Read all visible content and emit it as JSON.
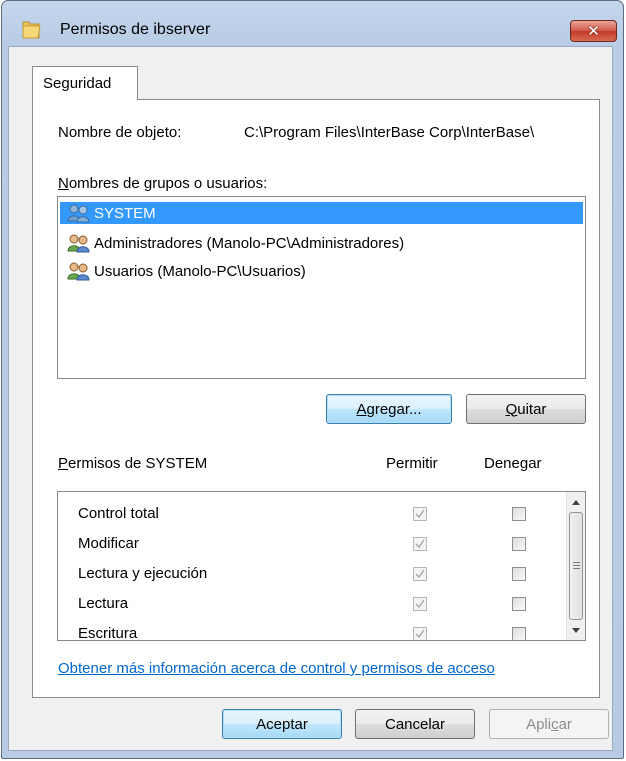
{
  "window": {
    "title": "Permisos de ibserver",
    "close_glyph": "✕"
  },
  "tabs": [
    {
      "label": "Seguridad"
    }
  ],
  "object": {
    "label": "Nombre de objeto:",
    "value": "C:\\Program Files\\InterBase Corp\\InterBase\\"
  },
  "groups": {
    "label_accesskey": "N",
    "label_rest": "ombres de grupos o usuarios:",
    "items": [
      {
        "label": "SYSTEM",
        "icon": "users-icon",
        "selected": true
      },
      {
        "label": "Administradores (Manolo-PC\\Administradores)",
        "icon": "users-icon",
        "selected": false
      },
      {
        "label": "Usuarios (Manolo-PC\\Usuarios)",
        "icon": "users-icon",
        "selected": false
      }
    ]
  },
  "buttons": {
    "add_accesskey": "A",
    "add_rest": "gregar...",
    "remove_accesskey": "Q",
    "remove_rest": "uitar",
    "ok": "Aceptar",
    "cancel": "Cancelar",
    "apply_before": "Apli",
    "apply_accesskey": "c",
    "apply_after": "ar"
  },
  "permissions": {
    "title_accesskey": "P",
    "title_rest": "ermisos de SYSTEM",
    "allow_header": "Permitir",
    "deny_header": "Denegar",
    "rows": [
      {
        "name": "Control total",
        "allow": true,
        "deny": false
      },
      {
        "name": "Modificar",
        "allow": true,
        "deny": false
      },
      {
        "name": "Lectura y ejecución",
        "allow": true,
        "deny": false
      },
      {
        "name": "Lectura",
        "allow": true,
        "deny": false
      },
      {
        "name": "Escritura",
        "allow": true,
        "deny": false
      }
    ]
  },
  "help_link": "Obtener más información acerca de control y permisos de acceso",
  "colors": {
    "selection": "#3399ff",
    "link": "#0066cc",
    "close_button": "#c43a2a"
  }
}
